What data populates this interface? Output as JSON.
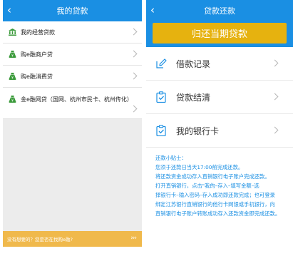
{
  "left": {
    "title": "我的贷款",
    "items": [
      {
        "label": "我的经营贷款",
        "icon": "bank-icon"
      },
      {
        "label": "购e融商户贷",
        "icon": "money-bag-icon"
      },
      {
        "label": "购e融消费贷",
        "icon": "money-bag-icon"
      },
      {
        "label": "金e融网贷（国网、杭州市民卡、杭州传化）",
        "icon": "money-bag-icon"
      }
    ],
    "bottom_text": "没有想要的？您是否在找购e融?",
    "bottom_arrows": "›››"
  },
  "right": {
    "title": "贷款还款",
    "repay_button": "归还当期贷款",
    "menu": [
      {
        "label": "借款记录",
        "icon": "pencil-edit-icon"
      },
      {
        "label": "贷款结清",
        "icon": "clipboard-check-icon"
      },
      {
        "label": "我的银行卡",
        "icon": "clipboard-check-icon"
      }
    ],
    "tips": [
      "还款小贴士：",
      "您须于还款日当天17:00前完成还款。",
      "将还款资金成功存入直销银行电子账户完成还款。",
      "打开直销银行，点击\"我的–存入–填写金额–选",
      "择银行卡–输入密码–存入成功即还款完成；也可登录",
      "绑定江苏银行直销银行的他行卡网银或手机银行，向",
      "直销银行电子账户转账成功存入还款资金即完成还款。"
    ]
  },
  "colors": {
    "nav_blue": "#1a8fe3",
    "gold_button": "#e6b20f",
    "bottom_bar": "#f0b94c",
    "icon_green": "#3a9a3a"
  }
}
